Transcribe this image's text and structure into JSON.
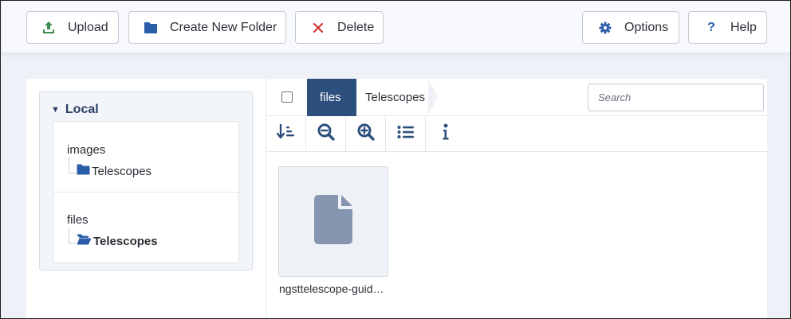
{
  "toolbar": {
    "upload_label": "Upload",
    "create_folder_label": "Create New Folder",
    "delete_label": "Delete",
    "options_label": "Options",
    "help_label": "Help",
    "colors": {
      "upload_icon": "#3d8b4f",
      "folder_icon": "#2b5ea8",
      "delete_icon": "#d0312d",
      "gear_icon": "#2b5ea8",
      "help_icon": "#2b5ea8"
    }
  },
  "tree": {
    "header": "Local",
    "drives": [
      {
        "name": "images",
        "folder": "Telescopes",
        "folder_state": "closed"
      },
      {
        "name": "files",
        "folder": "Telescopes",
        "folder_state": "open",
        "active": true
      }
    ]
  },
  "browser": {
    "breadcrumb": [
      "files",
      "Telescopes"
    ],
    "search_placeholder": "Search",
    "tools": [
      "sort-icon",
      "zoom-out-icon",
      "zoom-in-icon",
      "list-view-icon",
      "info-icon"
    ],
    "items": [
      {
        "name": "ngsttelescope-guid…",
        "type": "file",
        "icon": "file-icon"
      }
    ]
  },
  "colors": {
    "accent": "#2d4f7c",
    "icon_blue": "#2b5ea8",
    "file_icon": "#8796b0"
  }
}
